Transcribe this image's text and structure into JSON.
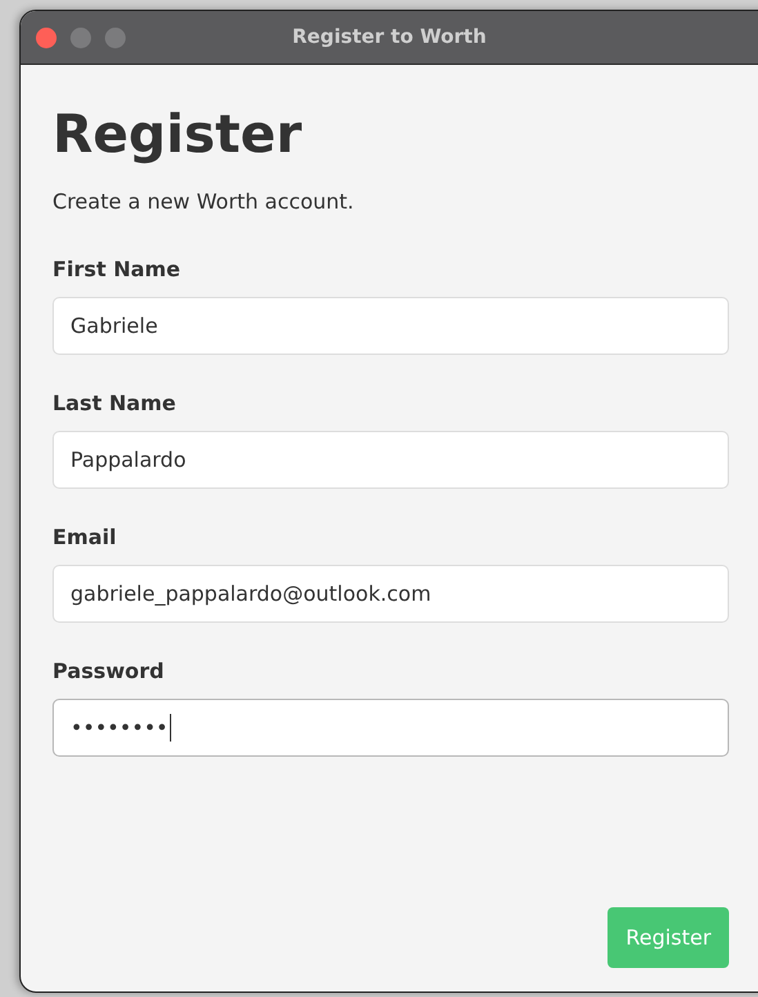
{
  "window": {
    "title": "Register to Worth"
  },
  "heading": "Register",
  "subtitle": "Create a new Worth account.",
  "fields": [
    {
      "label": "First Name",
      "value": "Gabriele",
      "focused": false
    },
    {
      "label": "Last Name",
      "value": "Pappalardo",
      "focused": false
    },
    {
      "label": "Email",
      "value": "gabriele_pappalardo@outlook.com",
      "focused": false
    },
    {
      "label": "Password",
      "value": "••••••••",
      "focused": true
    }
  ],
  "buttons": [
    "Register"
  ]
}
